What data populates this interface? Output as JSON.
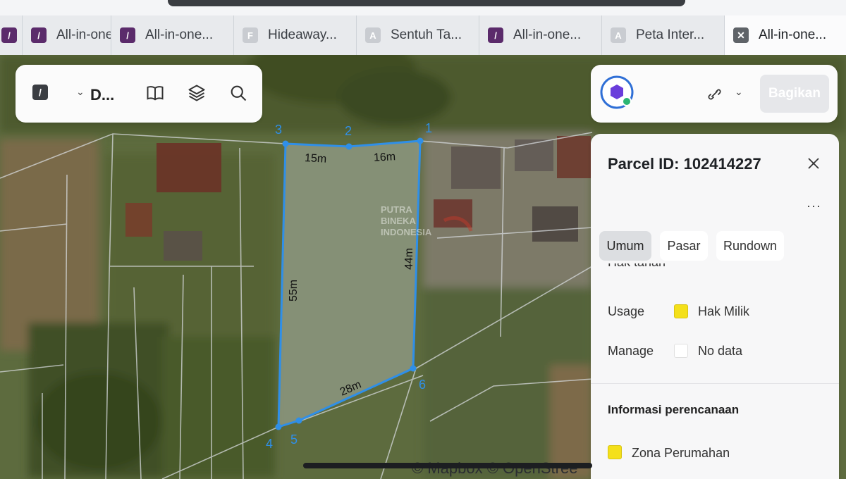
{
  "tabs": [
    {
      "label": "",
      "icon": "purple-logo-icon"
    },
    {
      "label": "All-in-one",
      "icon": "purple-logo-icon"
    },
    {
      "label": "All-in-one...",
      "icon": "purple-logo-icon"
    },
    {
      "label": "Hideaway...",
      "icon": "f-letter-icon",
      "letter": "F"
    },
    {
      "label": "Sentuh Ta...",
      "icon": "a-letter-icon",
      "letter": "A"
    },
    {
      "label": "All-in-one...",
      "icon": "purple-logo-icon"
    },
    {
      "label": "Peta Inter...",
      "icon": "a-letter-icon",
      "letter": "A"
    },
    {
      "label": "All-in-one...",
      "icon": "close-icon",
      "active": true
    }
  ],
  "toolbar_left": {
    "title": "D..."
  },
  "toolbar_right": {
    "share_label": "Bagikan"
  },
  "map": {
    "vertices": [
      "1",
      "2",
      "3",
      "4",
      "5",
      "6"
    ],
    "edges": [
      "15m",
      "16m",
      "44m",
      "55m",
      "28m"
    ],
    "watermark": [
      "PUTRA",
      "BINEKA",
      "INDONESIA"
    ],
    "attribution": "© Mapbox © OpenStree"
  },
  "panel": {
    "title": "Parcel ID: 102414227",
    "more": "···",
    "tabs": [
      "Umum",
      "Pasar",
      "Rundown"
    ],
    "cut_heading": "Hak tanah",
    "rows": [
      {
        "label": "Usage",
        "value": "Hak Milik",
        "swatch": "#f4e01a"
      },
      {
        "label": "Manage",
        "value": "No data",
        "swatch": "#ffffff"
      }
    ],
    "section": "Informasi perencanaan",
    "zone": {
      "value": "Zona Perumahan",
      "swatch": "#f4e01a"
    }
  },
  "colors": {
    "parcel_outline": "#2f8fe8",
    "accent_blue": "#2f6fd6"
  }
}
